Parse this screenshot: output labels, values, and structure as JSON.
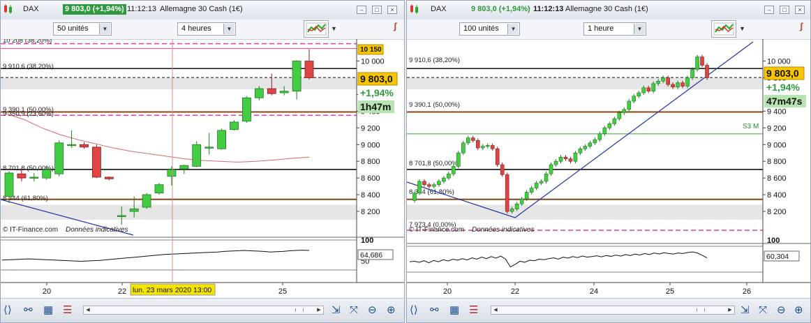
{
  "colors": {
    "up": "#44cc44",
    "down": "#dd4444",
    "gold": "#f7c600",
    "green_badge": "#2f9a3d",
    "fib_line": "#8b4513",
    "pink_dash": "#e0409a"
  },
  "panels": [
    {
      "header": {
        "symbol": "DAX",
        "quote": "9 803,0 (+1,94%)",
        "time": "11:12:13",
        "name": "Allemagne 30 Cash (1€)"
      },
      "units_select": "50 unités",
      "period_select": "4 heures",
      "price_badge": "9 803,0",
      "change_badge": "+1,94%",
      "countdown_badge": "1h47m",
      "top_badge": "10 150",
      "osc_value": "64,686",
      "cursor_label": "lun. 23 mars 2020 13:00",
      "copyright": "© IT-Finance.com",
      "disclaimer": "Données indicatives",
      "fib_labels": [
        "10 208 (38,20%)",
        "9 910,6 (38,20%)",
        "9 390,1 (50,00%)",
        "9 350,9 (23,60%)",
        "8 701,8 (50,00%)",
        "8 344 (61,80%)"
      ],
      "y_labels": [
        "10 000",
        "9 600",
        "9 400",
        "9 200",
        "9 000",
        "8 800",
        "8 600",
        "8 400",
        "8 200"
      ],
      "osc_labels": [
        "100",
        "50"
      ],
      "x_labels": [
        "20",
        "22",
        "25"
      ]
    },
    {
      "header": {
        "symbol": "DAX",
        "quote": "9 803,0 (+1,94%)",
        "time": "11:12:13",
        "name": "Allemagne 30 Cash (1€)"
      },
      "units_select": "100 unités",
      "period_select": "1 heure",
      "price_badge": "9 803,0",
      "change_badge": "+1,94%",
      "countdown_badge": "47m47s",
      "osc_value": "60,304",
      "s3_label": "S3 M",
      "copyright": "© IT-Finance.com",
      "disclaimer": "Données indicatives",
      "fib_labels": [
        "9 910,6 (38,20%)",
        "9 390,1 (50,00%)",
        "8 701,8 (50,00%)",
        "8 344 (61,80%)",
        "7 973,4 (0,00%)"
      ],
      "y_labels": [
        "10 000",
        "9 800",
        "9 400",
        "9 200",
        "9 000",
        "8 800",
        "8 600",
        "8 400",
        "8 200"
      ],
      "osc_labels": [
        "100"
      ],
      "x_labels": [
        "20",
        "22",
        "24",
        "25",
        "26"
      ]
    }
  ],
  "chart_data": [
    {
      "type": "candlestick",
      "title": "DAX — Allemagne 30 Cash (1€)",
      "interval": "4 heures",
      "ylim": [
        8050,
        10230
      ],
      "y_ticks": [
        10000,
        9600,
        9400,
        9200,
        9000,
        8800,
        8600,
        8400,
        8200
      ],
      "levels": [
        {
          "label": "10 208 (38,20%)",
          "value": 10208,
          "style": "pink-dash"
        },
        {
          "label": "10 150",
          "value": 10150,
          "style": "pink-solid"
        },
        {
          "label": "9 910,6 (38,20%)",
          "value": 9910.6,
          "style": "black"
        },
        {
          "label": "9 803,0",
          "value": 9803,
          "style": "black-dash"
        },
        {
          "label": "9 390,1 (50,00%)",
          "value": 9390.1,
          "style": "brown"
        },
        {
          "label": "9 350,9 (23,60%)",
          "value": 9350.9,
          "style": "pink-dash"
        },
        {
          "label": "8 701,8 (50,00%)",
          "value": 8701.8,
          "style": "black"
        },
        {
          "label": "8 344 (61,80%)",
          "value": 8344,
          "style": "brown"
        }
      ],
      "candles": [
        [
          8380,
          8660,
          8300,
          8680
        ],
        [
          8650,
          8600,
          8560,
          8720
        ],
        [
          8600,
          8610,
          8560,
          8660
        ],
        [
          8600,
          8700,
          8580,
          8740
        ],
        [
          8650,
          9020,
          8620,
          9050
        ],
        [
          9000,
          9000,
          8960,
          9170
        ],
        [
          9000,
          8970,
          8950,
          9030
        ],
        [
          8970,
          8610,
          8600,
          9000
        ],
        [
          8610,
          8590,
          8570,
          8620
        ],
        [
          8150,
          8150,
          8040,
          8260
        ],
        [
          8200,
          8230,
          8130,
          8380
        ],
        [
          8250,
          8400,
          8230,
          8420
        ],
        [
          8420,
          8520,
          8400,
          8540
        ],
        [
          8620,
          8700,
          8510,
          8740
        ],
        [
          8710,
          8750,
          8650,
          8760
        ],
        [
          8740,
          9000,
          8730,
          9040
        ],
        [
          8960,
          8970,
          8880,
          9140
        ],
        [
          8950,
          9170,
          8940,
          9190
        ],
        [
          9180,
          9270,
          9170,
          9290
        ],
        [
          9280,
          9560,
          9260,
          9580
        ],
        [
          9560,
          9670,
          9530,
          9700
        ],
        [
          9670,
          9610,
          9590,
          9850
        ],
        [
          9620,
          9640,
          9590,
          9700
        ],
        [
          9640,
          10000,
          9540,
          10010
        ],
        [
          10000,
          9800,
          9780,
          10140
        ]
      ],
      "moving_average": [
        9370,
        9300,
        9200,
        9120,
        9060,
        9010,
        8960,
        8920,
        8890,
        8860,
        8830,
        8810,
        8800,
        8790,
        8800,
        8815,
        8835,
        8850
      ],
      "oscillator": {
        "last": 64.686,
        "ylim": [
          0,
          100
        ]
      },
      "x_labels": [
        "20",
        "22",
        "25"
      ]
    },
    {
      "type": "candlestick",
      "title": "DAX — Allemagne 30 Cash (1€)",
      "interval": "1 heure",
      "ylim": [
        8050,
        10230
      ],
      "y_ticks": [
        10000,
        9800,
        9400,
        9200,
        9000,
        8800,
        8600,
        8400,
        8200
      ],
      "levels": [
        {
          "label": "9 910,6 (38,20%)",
          "value": 9910.6,
          "style": "black"
        },
        {
          "label": "9 803,0",
          "value": 9803,
          "style": "black-dash"
        },
        {
          "label": "9 390,1 (50,00%)",
          "value": 9390.1,
          "style": "brown"
        },
        {
          "label": "S3 M",
          "value": 9128,
          "style": "green"
        },
        {
          "label": "8 701,8 (50,00%)",
          "value": 8701.8,
          "style": "black"
        },
        {
          "label": "8 344 (61,80%)",
          "value": 8344,
          "style": "brown"
        },
        {
          "label": "7 973,4 (0,00%)",
          "value": 7973.4,
          "style": "pink-dash"
        }
      ],
      "price_path": [
        8330,
        8420,
        8560,
        8520,
        8500,
        8520,
        8560,
        8600,
        8650,
        8740,
        8900,
        9020,
        9080,
        9050,
        8960,
        8980,
        8990,
        8950,
        8760,
        8640,
        8200,
        8230,
        8290,
        8350,
        8430,
        8480,
        8540,
        8560,
        8650,
        8760,
        8800,
        8850,
        8830,
        8800,
        8900,
        8950,
        8980,
        9020,
        9060,
        9130,
        9200,
        9250,
        9310,
        9380,
        9420,
        9520,
        9580,
        9620,
        9680,
        9640,
        9730,
        9760,
        9800,
        9720,
        9690,
        9740,
        9700,
        9800,
        9900,
        10050,
        9950,
        9800
      ],
      "oscillator": {
        "last": 60.304,
        "ylim": [
          0,
          100
        ]
      },
      "x_labels": [
        "20",
        "22",
        "24",
        "25",
        "26"
      ]
    }
  ]
}
